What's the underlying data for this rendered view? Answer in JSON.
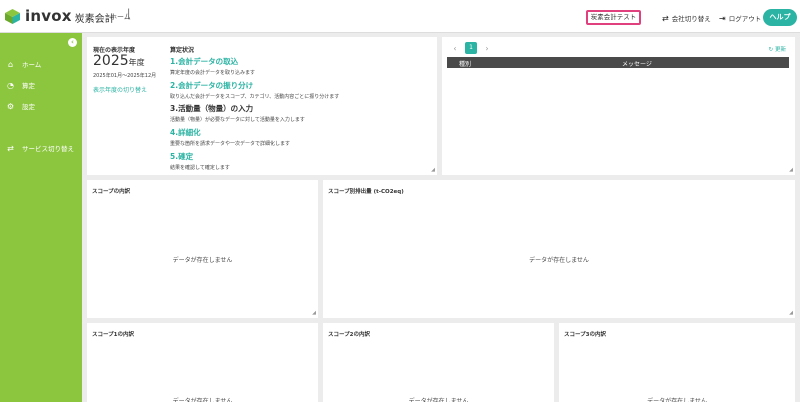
{
  "header": {
    "logo_word": "invox",
    "logo_sub": "炭素会計",
    "breadcrumb": "ホーム",
    "company_name": "炭素会計テスト",
    "switch_company": "会社切り替え",
    "logout": "ログアウト",
    "help": "ヘルプ"
  },
  "sidebar": {
    "items": [
      {
        "label": "ホーム",
        "icon": "home-icon"
      },
      {
        "label": "算定",
        "icon": "chart-icon"
      },
      {
        "label": "設定",
        "icon": "gear-icon"
      },
      {
        "label": "サービス切り替え",
        "icon": "swap-icon"
      }
    ],
    "color": "#8cc63f"
  },
  "period": {
    "label": "現在の表示年度",
    "year": "2025",
    "year_suffix": "年度",
    "range": "2025年01月～2025年12月",
    "switch_link": "表示年度の切り替え"
  },
  "steps": {
    "label": "算定状況",
    "items": [
      {
        "title": "1.会計データの取込",
        "desc": "算定年度の会計データを取り込みます"
      },
      {
        "title": "2.会計データの振り分け",
        "desc": "取り込んだ会計データをスコープ、カテゴリ、活動内容ごとに振り分けます"
      },
      {
        "title": "3.活動量（物量）の入力",
        "desc": "活動量（物量）が必要なデータに対して活動量を入力します"
      },
      {
        "title": "4.詳細化",
        "desc": "重要な箇所を請求データや一次データで詳細化します"
      },
      {
        "title": "5.確定",
        "desc": "結果を確認して確定します"
      }
    ]
  },
  "messages": {
    "page": "1",
    "refresh": "更新",
    "col_type": "種別",
    "col_message": "メッセージ"
  },
  "cards": {
    "scope_breakdown": "スコープの内訳",
    "scope_emissions": "スコープ別排出量 (t-CO2eq)",
    "scope1": "スコープ1の内訳",
    "scope2": "スコープ2の内訳",
    "scope3": "スコープ3の内訳",
    "empty": "データが存在しません"
  },
  "colors": {
    "accent": "#2bb3a3",
    "highlight": "#e0407e"
  }
}
